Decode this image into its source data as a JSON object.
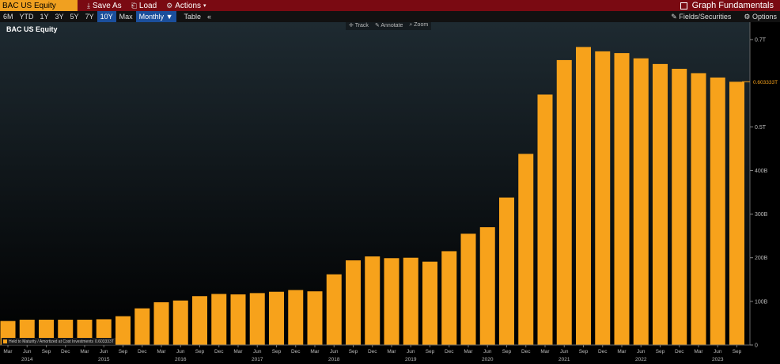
{
  "header": {
    "ticker": "BAC US Equity",
    "buttons": [
      {
        "label": "Save As",
        "icon": "save-icon"
      },
      {
        "label": "Load",
        "icon": "load-icon"
      },
      {
        "label": "Actions",
        "icon": "actions-icon",
        "suffix": "▾"
      }
    ],
    "graph_fundamentals": "Graph Fundamentals"
  },
  "toolbar": {
    "ranges": [
      "6M",
      "YTD",
      "1Y",
      "3Y",
      "5Y",
      "7Y",
      "10Y",
      "Max"
    ],
    "selected_range": "10Y",
    "frequency": "Monthly ▼",
    "table": "Table",
    "collapse": "«",
    "fields": "Fields/Securities",
    "options": "Options"
  },
  "chart_tools": [
    "Track",
    "Annotate",
    "Zoom"
  ],
  "colors": {
    "bar": "#f7a21b",
    "accent_red": "#7a0a12",
    "selected_blue": "#1b4f9c"
  },
  "chart_data": {
    "type": "bar",
    "title": "BAC US Equity",
    "series": [
      {
        "name": "Held to Maturity / Amortized at Cost Investments",
        "values": [
          55,
          58,
          58,
          58,
          58,
          59,
          66,
          84,
          98,
          102,
          112,
          117,
          116,
          119,
          122,
          126,
          123,
          162,
          194,
          203,
          199,
          200,
          191,
          215,
          255,
          270,
          338,
          438,
          574,
          653,
          683,
          673,
          669,
          657,
          644,
          633,
          623,
          613,
          603.333
        ]
      }
    ],
    "x_tick_labels": [
      "Mar",
      "Jun",
      "Sep",
      "Dec",
      "Mar",
      "Jun",
      "Sep",
      "Dec",
      "Mar",
      "Jun",
      "Sep",
      "Dec",
      "Mar",
      "Jun",
      "Sep",
      "Dec",
      "Mar",
      "Jun",
      "Sep",
      "Dec",
      "Mar",
      "Jun",
      "Sep",
      "Dec",
      "Mar",
      "Jun",
      "Sep",
      "Dec",
      "Mar",
      "Jun",
      "Sep",
      "Dec",
      "Mar",
      "Jun",
      "Sep",
      "Dec",
      "Mar",
      "Jun",
      "Sep"
    ],
    "year_labels": [
      {
        "label": "2014",
        "index": 1
      },
      {
        "label": "2015",
        "index": 5
      },
      {
        "label": "2016",
        "index": 9
      },
      {
        "label": "2017",
        "index": 13
      },
      {
        "label": "2018",
        "index": 17
      },
      {
        "label": "2019",
        "index": 21
      },
      {
        "label": "2020",
        "index": 25
      },
      {
        "label": "2021",
        "index": 29
      },
      {
        "label": "2022",
        "index": 33
      },
      {
        "label": "2023",
        "index": 37
      }
    ],
    "y_ticks": [
      {
        "value": 0,
        "label": "0"
      },
      {
        "value": 100,
        "label": "100B"
      },
      {
        "value": 200,
        "label": "200B"
      },
      {
        "value": 300,
        "label": "300B"
      },
      {
        "value": 400,
        "label": "400B"
      },
      {
        "value": 500,
        "label": "0.5T"
      },
      {
        "value": 700,
        "label": "0.7T"
      }
    ],
    "ylim": [
      0,
      700
    ],
    "last_value_label": "0.603333T",
    "legend_text": "Held to Maturity / Amortized at Cost Investments",
    "legend_value": "0.603333T"
  }
}
